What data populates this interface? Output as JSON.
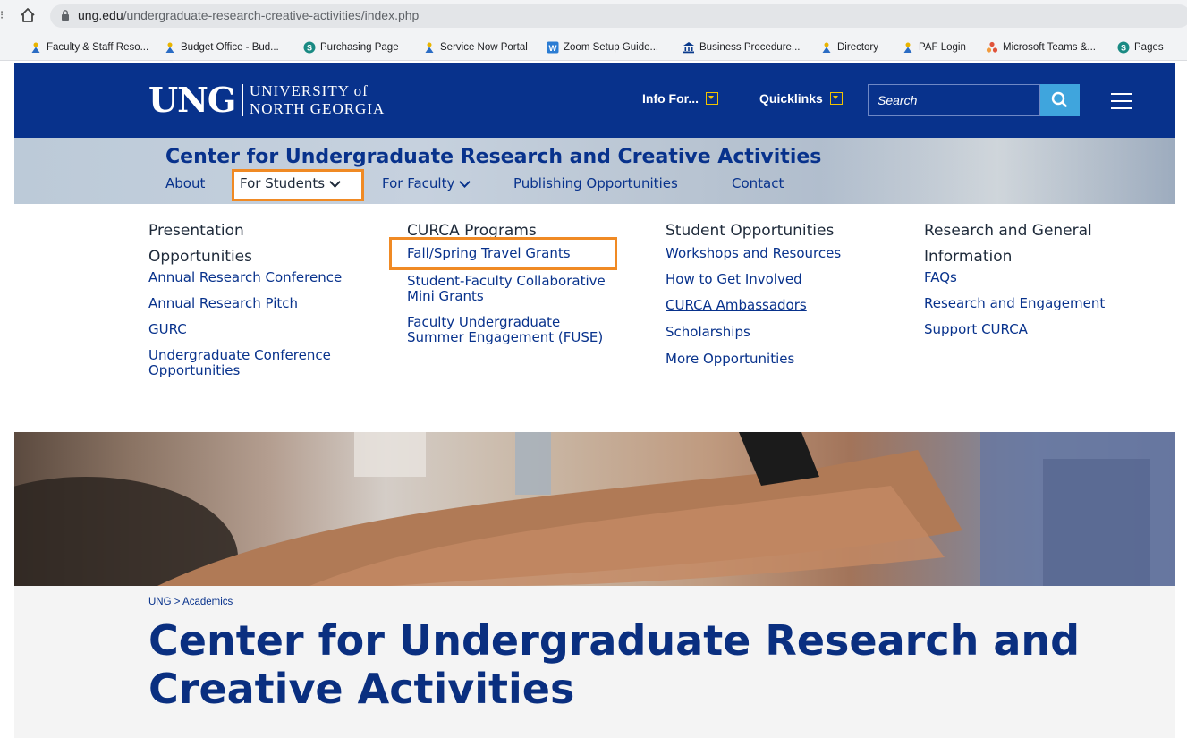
{
  "browser": {
    "url_host": "ung.edu",
    "url_path": "/undergraduate-research-creative-activities/index.php",
    "bookmarks": [
      {
        "label": "Faculty & Staff Reso...",
        "icon": "person-icon"
      },
      {
        "label": "Budget Office - Bud...",
        "icon": "person-icon"
      },
      {
        "label": "Purchasing Page",
        "icon": "sharepoint-icon"
      },
      {
        "label": "Service Now Portal",
        "icon": "person-icon"
      },
      {
        "label": "Zoom Setup Guide...",
        "icon": "word-icon"
      },
      {
        "label": "Business Procedure...",
        "icon": "bank-icon"
      },
      {
        "label": "Directory",
        "icon": "person-icon"
      },
      {
        "label": "PAF Login",
        "icon": "person-icon"
      },
      {
        "label": "Microsoft Teams &...",
        "icon": "apps-icon"
      },
      {
        "label": "Pages",
        "icon": "sharepoint-icon"
      }
    ]
  },
  "header": {
    "logo_abbr": "UNG",
    "logo_line1": "UNIVERSITY of",
    "logo_line2": "NORTH GEORGIA",
    "info_for": "Info For...",
    "quicklinks": "Quicklinks",
    "search_placeholder": "Search"
  },
  "subheader": {
    "title": "Center for Undergraduate Research and Creative Activities",
    "nav": {
      "about": "About",
      "for_students": "For Students",
      "for_faculty": "For Faculty",
      "publishing": "Publishing Opportunities",
      "contact": "Contact"
    }
  },
  "mega_menu": {
    "col1": {
      "head_l1": "Presentation",
      "head_l2": "Opportunities",
      "links": [
        "Annual Research Conference",
        "Annual Research Pitch",
        "GURC",
        "Undergraduate Conference Opportunities"
      ]
    },
    "col2": {
      "head": "CURCA Programs",
      "links": [
        "Fall/Spring Travel Grants",
        "Student-Faculty Collaborative Mini Grants",
        "Faculty Undergraduate Summer Engagement (FUSE)"
      ]
    },
    "col3": {
      "head": "Student Opportunities",
      "links": [
        "Workshops and Resources",
        "How to Get Involved",
        "CURCA Ambassadors",
        "Scholarships",
        "More Opportunities"
      ]
    },
    "col4": {
      "head_l1": "Research and General",
      "head_l2": "Information",
      "links": [
        "FAQs",
        "Research and Engagement",
        "Support CURCA"
      ]
    }
  },
  "page": {
    "breadcrumb": "UNG > Academics",
    "title": "Center for Undergraduate Research and Creative Activities"
  },
  "colors": {
    "brand_blue": "#08328C",
    "highlight_orange": "#F08A24",
    "search_button": "#3FA5DD",
    "dropdown_accent": "#F2C300"
  }
}
